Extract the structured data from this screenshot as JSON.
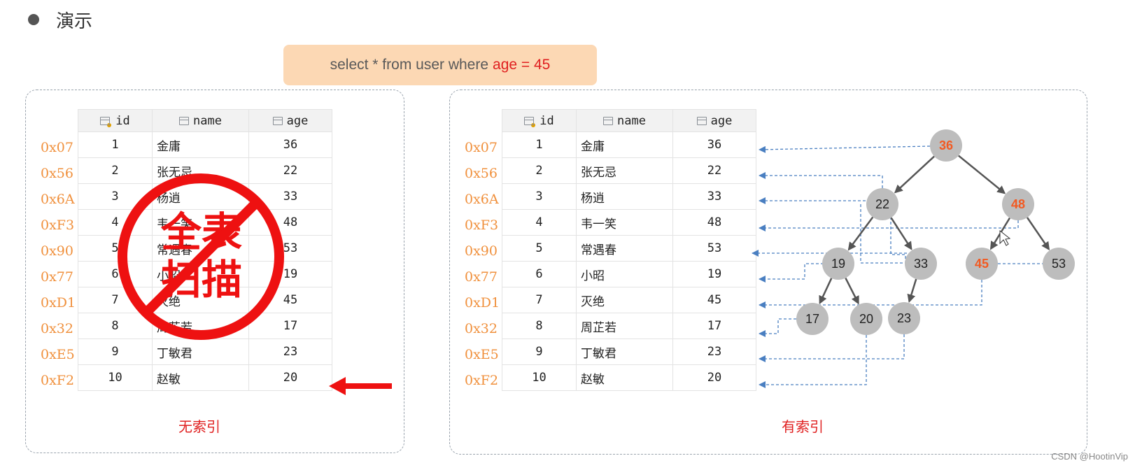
{
  "heading": "演示",
  "sql": {
    "text": "select * from user where",
    "condition": "age = 45"
  },
  "columns": [
    "id",
    "name",
    "age"
  ],
  "addresses": [
    "0x07",
    "0x56",
    "0x6A",
    "0xF3",
    "0x90",
    "0x77",
    "0xD1",
    "0x32",
    "0xE5",
    "0xF2"
  ],
  "rows": [
    {
      "id": "1",
      "name": "金庸",
      "age": "36"
    },
    {
      "id": "2",
      "name": "张无忌",
      "age": "22"
    },
    {
      "id": "3",
      "name": "杨逍",
      "age": "33"
    },
    {
      "id": "4",
      "name": "韦一笑",
      "age": "48"
    },
    {
      "id": "5",
      "name": "常遇春",
      "age": "53"
    },
    {
      "id": "6",
      "name": "小昭",
      "age": "19"
    },
    {
      "id": "7",
      "name": "灭绝",
      "age": "45"
    },
    {
      "id": "8",
      "name": "周芷若",
      "age": "17"
    },
    {
      "id": "9",
      "name": "丁敏君",
      "age": "23"
    },
    {
      "id": "10",
      "name": "赵敏",
      "age": "20"
    }
  ],
  "left_caption": "无索引",
  "right_caption": "有索引",
  "stamp_text": [
    "全表",
    "扫描"
  ],
  "tree_nodes": [
    {
      "key": "n36",
      "value": "36",
      "highlight": true
    },
    {
      "key": "n22",
      "value": "22",
      "highlight": false
    },
    {
      "key": "n48",
      "value": "48",
      "highlight": true
    },
    {
      "key": "n19",
      "value": "19",
      "highlight": false
    },
    {
      "key": "n33",
      "value": "33",
      "highlight": false
    },
    {
      "key": "n45",
      "value": "45",
      "highlight": true
    },
    {
      "key": "n53",
      "value": "53",
      "highlight": false
    },
    {
      "key": "n17",
      "value": "17",
      "highlight": false
    },
    {
      "key": "n20",
      "value": "20",
      "highlight": false
    },
    {
      "key": "n23",
      "value": "23",
      "highlight": false
    }
  ],
  "colors": {
    "address": "#f0903c",
    "highlight": "#f25a22",
    "node_fill": "#bdbdbd",
    "caption": "#e02020",
    "pointer": "#4a7fc1",
    "stamp": "#ee1111"
  },
  "watermark": "CSDN @HootinVip"
}
